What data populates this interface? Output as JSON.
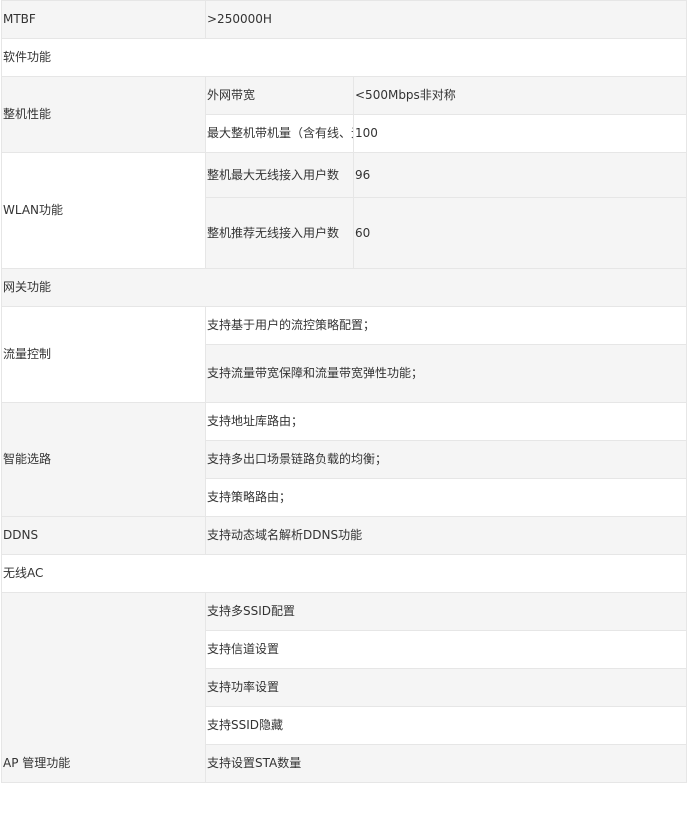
{
  "rows": {
    "mtbf": {
      "label": "MTBF",
      "value": ">250000H"
    },
    "software_header": "软件功能",
    "perf": {
      "label": "整机性能",
      "wan_bw": {
        "label": "外网带宽",
        "value": "<500Mbps非对称"
      },
      "max_load": {
        "label": "最大整机带机量（含有线、无线）",
        "value": "100"
      }
    },
    "wlan": {
      "label": "WLAN功能",
      "max_users": {
        "label": "整机最大无线接入用户数",
        "value": "96"
      },
      "rec_users": {
        "label": "整机推荐无线接入用户数",
        "value": "60"
      }
    },
    "gateway_header": "网关功能",
    "flow": {
      "label": "流量控制",
      "items": [
        "支持基于用户的流控策略配置；",
        "支持流量带宽保障和流量带宽弹性功能；"
      ]
    },
    "routing": {
      "label": "智能选路",
      "items": [
        "支持地址库路由；",
        "支持多出口场景链路负载的均衡；",
        "支持策略路由；"
      ]
    },
    "ddns": {
      "label": "DDNS",
      "value": "支持动态域名解析DDNS功能"
    },
    "wireless_ac_header": "无线AC",
    "ap": {
      "label": "AP 管理功能",
      "items": [
        "支持多SSID配置",
        "支持信道设置",
        "支持功率设置",
        "支持SSID隐藏",
        "支持设置STA数量"
      ]
    }
  }
}
